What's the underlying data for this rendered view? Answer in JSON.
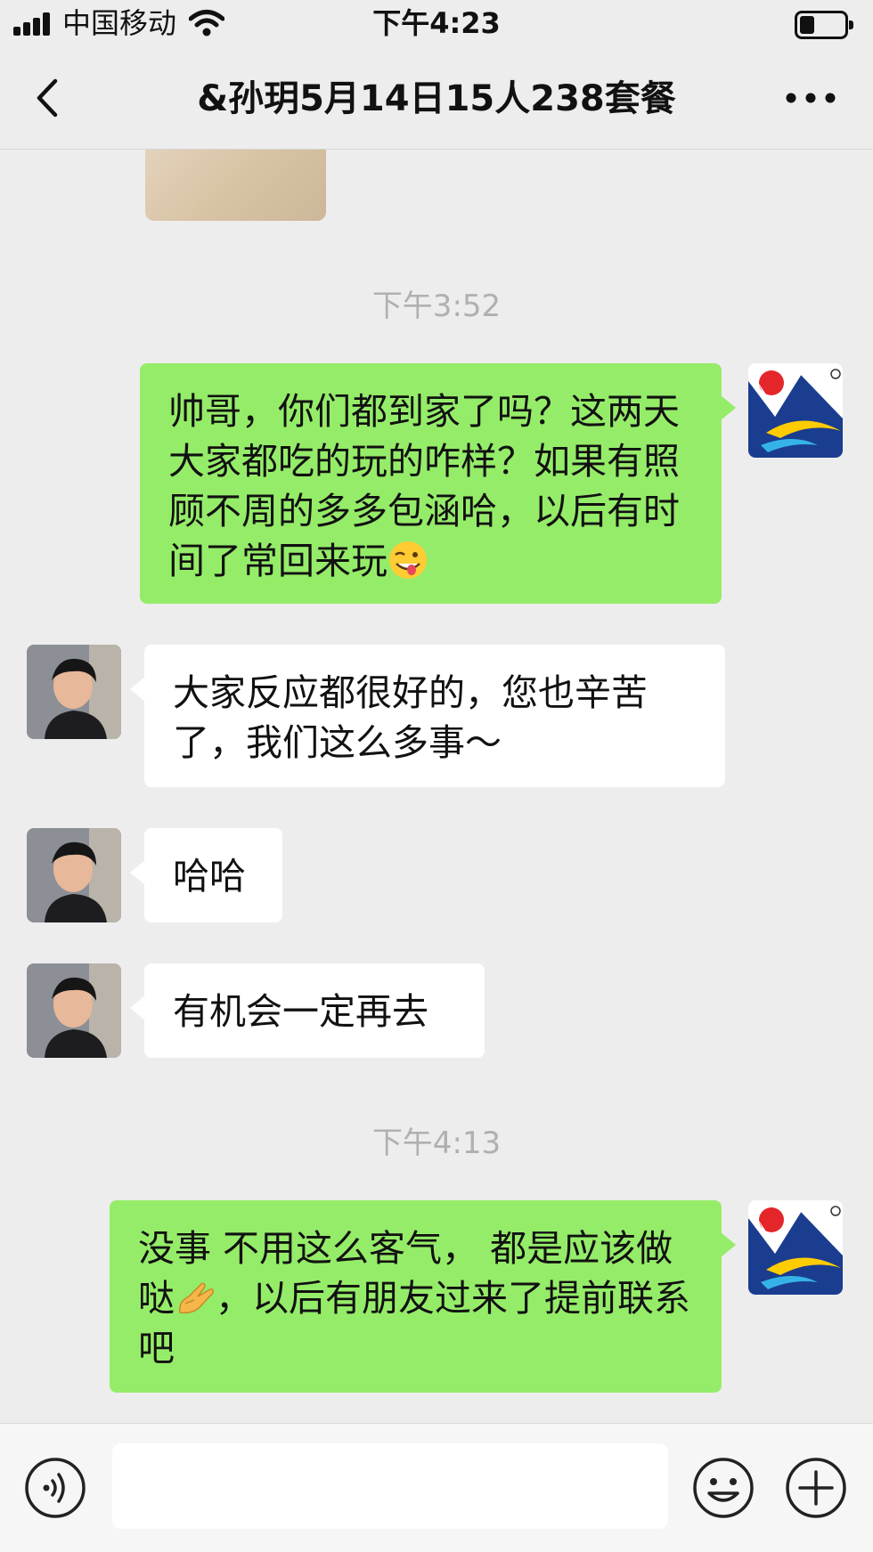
{
  "status_bar": {
    "carrier": "中国移动",
    "time": "下午4:23"
  },
  "nav": {
    "title": "&孙玥5月14日15人238套餐",
    "back_icon": "chevron-left-icon",
    "more_icon": "more-dots-icon"
  },
  "chat": {
    "timestamps": [
      "下午3:52",
      "下午4:13"
    ],
    "messages": [
      {
        "direction": "out",
        "sender": "self",
        "text": "帅哥，你们都到家了吗？这两天大家都吃的玩的咋样？如果有照顾不周的多多包涵哈，以后有时间了常回来玩",
        "emoji": "winking-face-with-tongue"
      },
      {
        "direction": "in",
        "sender": "contact",
        "text": "大家反应都很好的，您也辛苦了，我们这么多事～"
      },
      {
        "direction": "in",
        "sender": "contact",
        "text": "哈哈"
      },
      {
        "direction": "in",
        "sender": "contact",
        "text": "有机会一定再去"
      },
      {
        "direction": "out",
        "sender": "self",
        "text_before": "没事  不用这么客气， 都是应该做哒",
        "emoji": "pinching-hand",
        "text_after": "，以后有朋友过来了提前联系吧"
      }
    ]
  },
  "input_bar": {
    "voice_icon": "voice-icon",
    "emoji_icon": "smiley-icon",
    "plus_icon": "plus-icon",
    "input_value": ""
  },
  "colors": {
    "background": "#ededed",
    "outgoing_bubble": "#95ec69",
    "incoming_bubble": "#ffffff",
    "timestamp_text": "#b0b0b0"
  }
}
